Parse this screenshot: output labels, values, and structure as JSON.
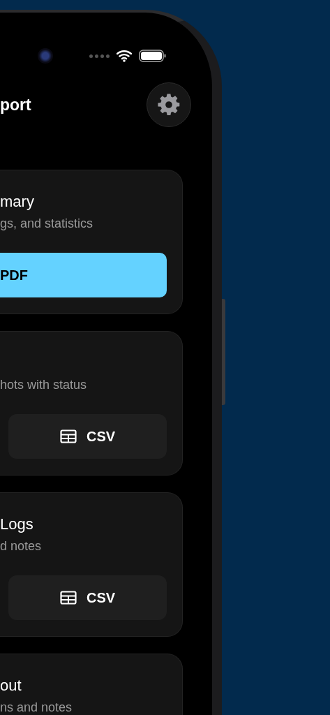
{
  "header": {
    "title": "port"
  },
  "cards": [
    {
      "title": "mary",
      "subtitle": "gs, and statistics",
      "button": {
        "kind": "primary",
        "label": "PDF"
      }
    },
    {
      "subtitle": "hots with status",
      "button": {
        "kind": "secondary",
        "label": "CSV"
      }
    },
    {
      "title": "Logs",
      "subtitle": "d notes",
      "button": {
        "kind": "secondary",
        "label": "CSV"
      }
    },
    {
      "title": "out",
      "subtitle": "ns and notes"
    }
  ]
}
